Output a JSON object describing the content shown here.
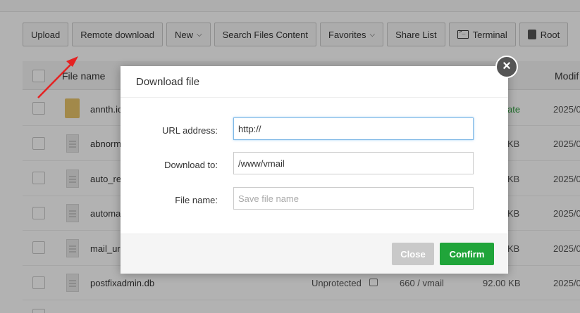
{
  "toolbar": {
    "upload": "Upload",
    "remote_download": "Remote download",
    "new": "New",
    "search_files": "Search Files Content",
    "favorites": "Favorites",
    "share_list": "Share List",
    "terminal": "Terminal",
    "root": "Root"
  },
  "table": {
    "col_name": "File name",
    "col_modified": "Modif",
    "rows": [
      {
        "name": "annth.ic",
        "extra": "ate",
        "date": "2025/0"
      },
      {
        "name": "abnorm",
        "size": "KB",
        "date": "2025/0"
      },
      {
        "name": "auto_re",
        "size": "KB",
        "date": "2025/0"
      },
      {
        "name": "automa",
        "size": "KB",
        "date": "2025/0"
      },
      {
        "name": "mail_ur",
        "size": "KB",
        "date": "2025/0"
      },
      {
        "name": "postfixadmin.db",
        "protection": "Unprotected",
        "perm": "660 / vmail",
        "size": "92.00 KB",
        "date": "2025/0"
      }
    ]
  },
  "modal": {
    "title": "Download file",
    "url_label": "URL address:",
    "url_value": "http://",
    "download_to_label": "Download to:",
    "download_to_value": "/www/vmail",
    "file_name_label": "File name:",
    "file_name_placeholder": "Save file name",
    "close_label": "Close",
    "confirm_label": "Confirm",
    "close_icon": "×"
  },
  "colors": {
    "confirm": "#20a53a",
    "close": "#c9c9c9",
    "arrow": "#e52222"
  }
}
